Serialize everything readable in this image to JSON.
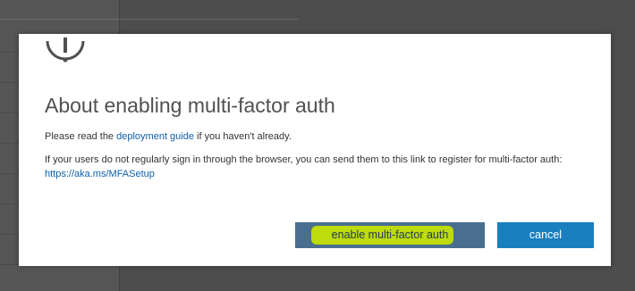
{
  "dialog": {
    "icon": "exclamation-circle-icon",
    "title": "About enabling multi-factor auth",
    "para1": {
      "before": "Please read the ",
      "link": "deployment guide",
      "after": " if you haven't already."
    },
    "para2": {
      "text": "If your users do not regularly sign in through the browser, you can send them to this link to register for multi-factor auth: ",
      "link": "https://aka.ms/MFASetup"
    },
    "buttons": {
      "enable": "enable multi-factor auth",
      "cancel": "cancel"
    }
  },
  "colors": {
    "overlay": "#4d4d4d",
    "title_text": "#505050",
    "link": "#0f5fa8",
    "enable_button": "#4a6f8e",
    "cancel_button": "#1a7fbf",
    "highlight": "#c8e400"
  }
}
